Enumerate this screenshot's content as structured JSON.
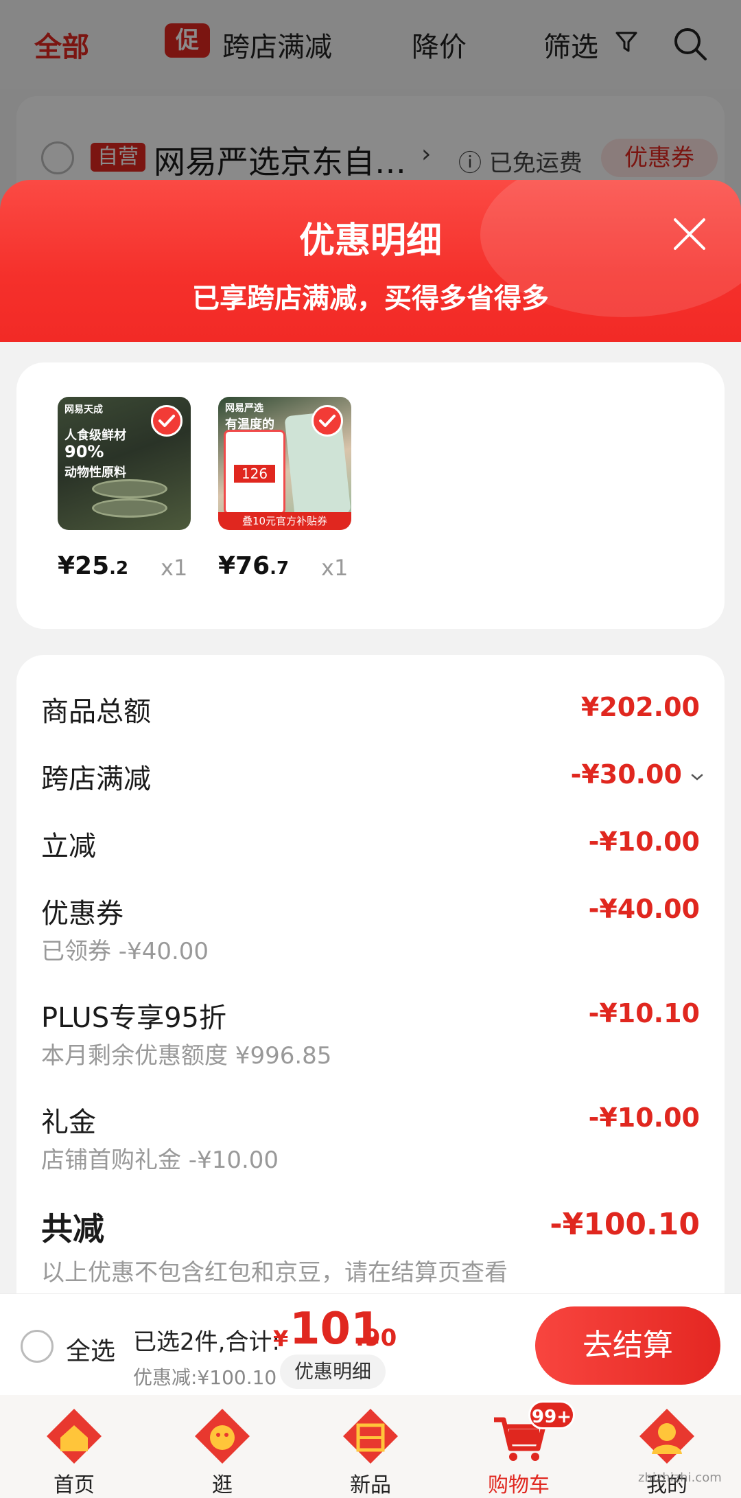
{
  "filter_bar": {
    "tab_all": "全部",
    "promo_badge": "促",
    "tab_cross_store": "跨店满减",
    "tab_price_drop": "降价",
    "tab_filter": "筛选"
  },
  "store": {
    "self_badge": "自营",
    "name": "网易严选京东自…",
    "chevron": "›",
    "free_shipping": "ⓘ 已免运费",
    "coupon_chip": "优惠券"
  },
  "sheet": {
    "title": "优惠明细",
    "subtitle": "已享跨店满减，买得多省得多"
  },
  "items": [
    {
      "price_int": "¥25",
      "price_dec": ".2",
      "qty": "x1",
      "thumb_text": [
        "网易天成",
        "人食级鲜材",
        "90%",
        "动物性原料"
      ]
    },
    {
      "price_int": "¥76",
      "price_dec": ".7",
      "qty": "x1",
      "thumb_text": [
        "网易严选",
        "有温度的",
        "126",
        "叠10元官方补贴券"
      ]
    }
  ],
  "summary": {
    "goods_total_label": "商品总额",
    "goods_total_value": "¥202.00",
    "cross_store_label": "跨店满减",
    "cross_store_value": "-¥30.00",
    "instant_label": "立减",
    "instant_value": "-¥10.00",
    "coupon_label": "优惠券",
    "coupon_value": "-¥40.00",
    "coupon_sub": "已领券 -¥40.00",
    "plus_label": "PLUS专享95折",
    "plus_value": "-¥10.10",
    "plus_sub": "本月剩余优惠额度 ¥996.85",
    "gift_label": "礼金",
    "gift_value": "-¥10.00",
    "gift_sub": "店铺首购礼金 -¥10.00",
    "total_label": "共减",
    "total_value": "-¥100.10",
    "total_note": "以上优惠不包含红包和京豆，请在结算页查看"
  },
  "checkout": {
    "select_all": "全选",
    "selected_info": "已选2件,合计:",
    "yen": "¥",
    "amount_int": "101",
    "amount_dec": ".90",
    "discount_info": "优惠减:¥100.10",
    "detail_chip": "优惠明细",
    "button": "去结算"
  },
  "nav": {
    "home": "首页",
    "browse": "逛",
    "new": "新品",
    "cart": "购物车",
    "mine": "我的",
    "cart_badge": "99+"
  },
  "watermark": "zhizhizhi.com",
  "colors": {
    "accent": "#e0271f",
    "sheet_header": "#f5302b"
  }
}
